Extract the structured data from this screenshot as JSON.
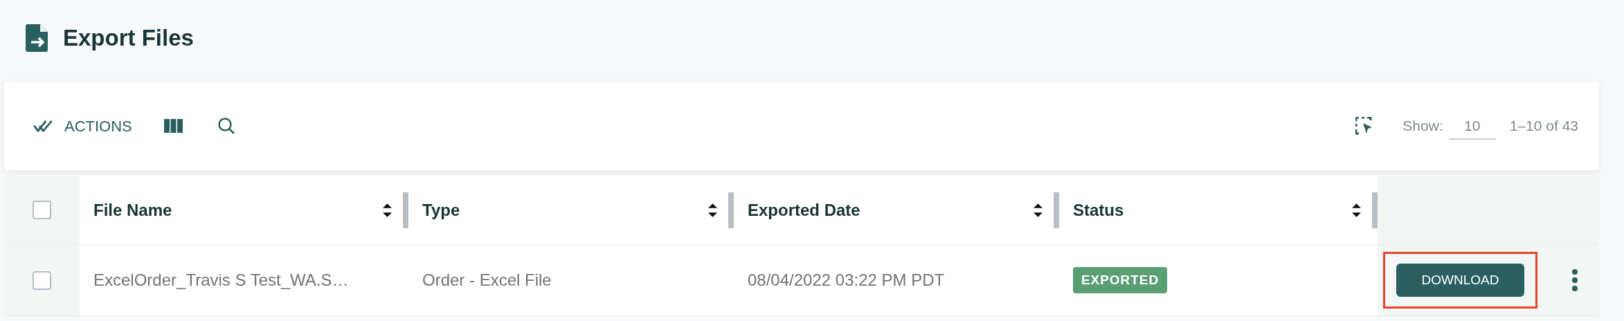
{
  "page": {
    "title": "Export Files"
  },
  "toolbar": {
    "actions_label": "ACTIONS",
    "show_label": "Show:",
    "page_size": "10",
    "range": "1–10 of 43"
  },
  "table": {
    "select_all": {
      "checked": false
    },
    "columns": [
      {
        "label": "File Name"
      },
      {
        "label": "Type"
      },
      {
        "label": "Exported Date"
      },
      {
        "label": "Status"
      }
    ],
    "rows": [
      {
        "checked": false,
        "file_name": "ExcelOrder_Travis S Test_WA.S…",
        "type": "Order - Excel File",
        "exported_date": "08/04/2022 03:22 PM PDT",
        "status": {
          "label": "EXPORTED",
          "kind": "exported"
        },
        "action": "DOWNLOAD",
        "highlighted": true
      }
    ]
  }
}
